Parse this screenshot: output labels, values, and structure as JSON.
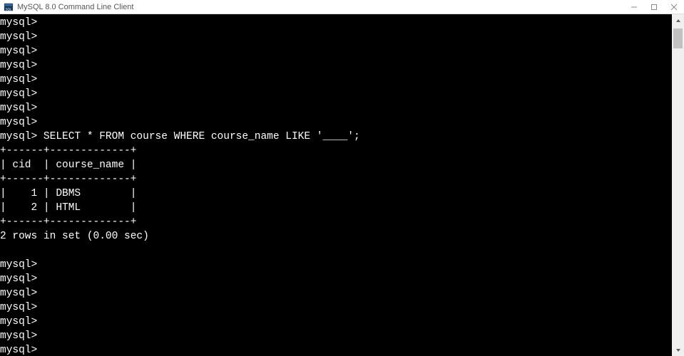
{
  "window": {
    "title": "MySQL 8.0 Command Line Client"
  },
  "terminal": {
    "prompt": "mysql>",
    "empty_prompts_before": 8,
    "query": "SELECT * FROM course WHERE course_name LIKE '____';",
    "table": {
      "divider": "+------+-------------+",
      "header": "| cid  | course_name |",
      "rows": [
        "|    1 | DBMS        |",
        "|    2 | HTML        |"
      ]
    },
    "result_status": "2 rows in set (0.00 sec)",
    "empty_prompts_after": 7
  },
  "chart_data": {
    "type": "table",
    "title": "course",
    "columns": [
      "cid",
      "course_name"
    ],
    "rows": [
      {
        "cid": 1,
        "course_name": "DBMS"
      },
      {
        "cid": 2,
        "course_name": "HTML"
      }
    ]
  }
}
